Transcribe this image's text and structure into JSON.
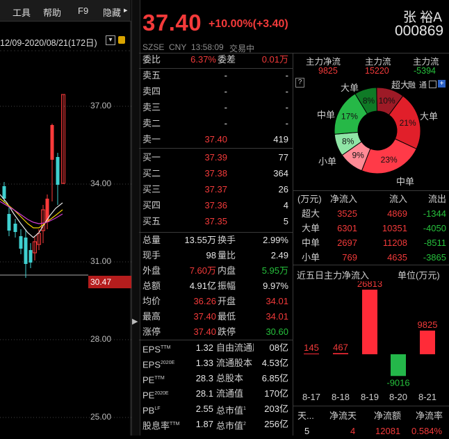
{
  "toolbar": {
    "tools": "工具",
    "help": "帮助",
    "f9": "F9",
    "hide": "隐藏"
  },
  "chart": {
    "date_range": "12/09-2020/08/21(172日)",
    "y_ticks": [
      "37.00",
      "34.00",
      "31.00",
      "28.00",
      "25.00"
    ],
    "crosshair_value": "30.47"
  },
  "quote": {
    "price": "37.40",
    "change": "+10.00%(+3.40)",
    "name": "张 裕A",
    "code": "000869",
    "market": "SZSE",
    "currency": "CNY",
    "time": "13:58:09",
    "status": "交易中"
  },
  "ratio": {
    "label1": "委比",
    "v1": "6.37%",
    "label2": "委差",
    "v2": "0.01万"
  },
  "asks": [
    {
      "label": "卖五",
      "price": "-",
      "vol": "-"
    },
    {
      "label": "卖四",
      "price": "-",
      "vol": "-"
    },
    {
      "label": "卖三",
      "price": "-",
      "vol": "-"
    },
    {
      "label": "卖二",
      "price": "-",
      "vol": "-"
    },
    {
      "label": "卖一",
      "price": "37.40",
      "vol": "419"
    }
  ],
  "bids": [
    {
      "label": "买一",
      "price": "37.39",
      "vol": "77"
    },
    {
      "label": "买二",
      "price": "37.38",
      "vol": "364"
    },
    {
      "label": "买三",
      "price": "37.37",
      "vol": "26"
    },
    {
      "label": "买四",
      "price": "37.36",
      "vol": "4"
    },
    {
      "label": "买五",
      "price": "37.35",
      "vol": "5"
    }
  ],
  "stats": [
    {
      "l1": "总量",
      "v1": "13.55万",
      "l2": "换手",
      "v2": "2.99%"
    },
    {
      "l1": "现手",
      "v1": "98",
      "l2": "量比",
      "v2": "2.49"
    },
    {
      "l1": "外盘",
      "v1": "7.60万",
      "l2": "内盘",
      "v2": "5.95万"
    },
    {
      "l1": "总额",
      "v1": "4.91亿",
      "l2": "振幅",
      "v2": "9.97%"
    },
    {
      "l1": "均价",
      "v1": "36.26",
      "l2": "开盘",
      "v2": "34.01"
    },
    {
      "l1": "最高",
      "v1": "37.40",
      "l2": "最低",
      "v2": "34.01"
    },
    {
      "l1": "涨停",
      "v1": "37.40",
      "l2": "跌停",
      "v2": "30.60"
    }
  ],
  "finance": [
    {
      "l1": "EPS",
      "s1": "TTM",
      "v1": "1.32",
      "l2": "自由流通股本",
      "v2": "08亿"
    },
    {
      "l1": "EPS",
      "s1": "2020E",
      "v1": "1.33",
      "l2": "流通股本",
      "v2": "4.53亿"
    },
    {
      "l1": "PE",
      "s1": "TTM",
      "v1": "28.3",
      "l2": "总股本",
      "v2": "6.85亿"
    },
    {
      "l1": "PE",
      "s1": "2020E",
      "v1": "28.1",
      "l2": "流通值",
      "v2": "170亿"
    },
    {
      "l1": "PB",
      "s1": "LF",
      "v1": "2.55",
      "l2": "总市值",
      "s2": "1",
      "v2": "203亿"
    },
    {
      "l1": "股息率",
      "s1": "TTM",
      "v1": "1.87",
      "l2": "总市值",
      "s2": "2",
      "v2": "256亿"
    }
  ],
  "mainflow": {
    "h1": "主力净流",
    "h2": "主力流",
    "h3": "主力流",
    "v1": "9825",
    "v2": "15220",
    "v3": "-5394",
    "help": "?",
    "icon_labels": [
      "融",
      "通"
    ]
  },
  "donut": {
    "labels": [
      "大单",
      "超大",
      "中单",
      "大单",
      "小单",
      "中单"
    ],
    "slices": [
      {
        "pct": "10%",
        "value": 10,
        "color": "#9d1a26"
      },
      {
        "pct": "21%",
        "value": 21,
        "color": "#e11f2a"
      },
      {
        "pct": "23%",
        "value": 23,
        "color": "#ff3a48"
      },
      {
        "pct": "9%",
        "value": 9,
        "color": "#ff8a95"
      },
      {
        "pct": "8%",
        "value": 8,
        "color": "#8fe5a6"
      },
      {
        "pct": "17%",
        "value": 17,
        "color": "#26b847"
      },
      {
        "pct": "8%",
        "value": 8,
        "color": "#0f7a26"
      }
    ]
  },
  "flow_table": {
    "headers": [
      "(万元)",
      "净流入",
      "流入",
      "流出"
    ],
    "rows": [
      {
        "label": "超大",
        "net": "3525",
        "in": "4869",
        "out": "-1344"
      },
      {
        "label": "大单",
        "net": "6301",
        "in": "10351",
        "out": "-4050"
      },
      {
        "label": "中单",
        "net": "2697",
        "in": "11208",
        "out": "-8511"
      },
      {
        "label": "小单",
        "net": "769",
        "in": "4635",
        "out": "-3865"
      }
    ]
  },
  "five_day": {
    "title": "近五日主力净流入",
    "unit": "单位(万元)",
    "bars": [
      {
        "date": "8-17",
        "value": 145
      },
      {
        "date": "8-18",
        "value": 467
      },
      {
        "date": "8-19",
        "value": 26813
      },
      {
        "date": "8-20",
        "value": -9016
      },
      {
        "date": "8-21",
        "value": 9825
      }
    ],
    "labels": [
      "145",
      "467",
      "26813",
      "-9016",
      "9825"
    ]
  },
  "bottom_table": {
    "headers": [
      "天...",
      "净流天",
      "净流额",
      "净流率"
    ],
    "row": [
      "5",
      "4",
      "12081",
      "0.584%"
    ]
  }
}
